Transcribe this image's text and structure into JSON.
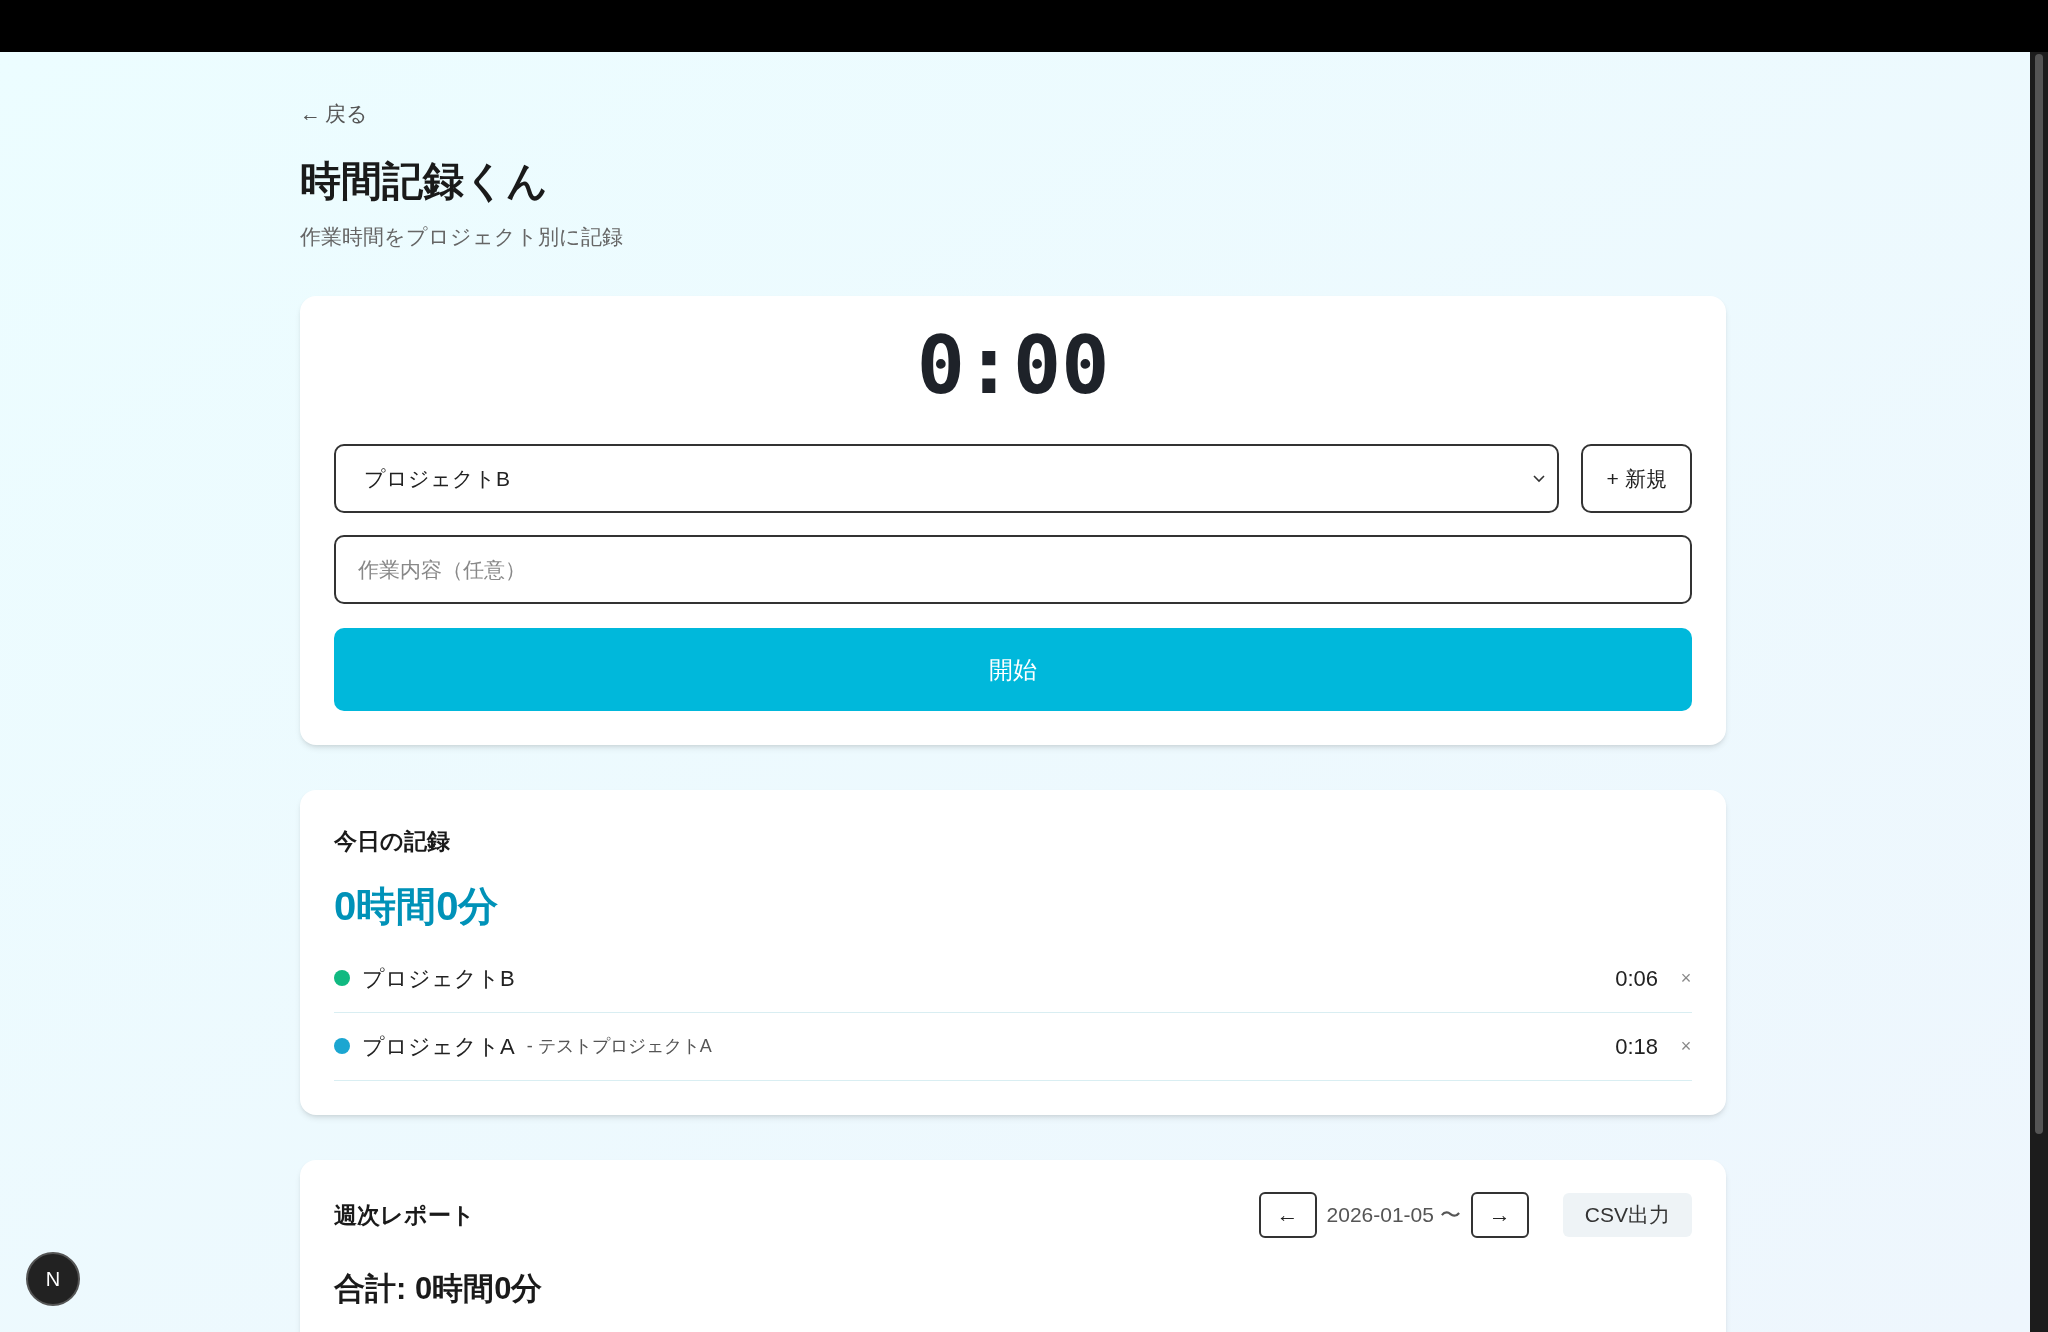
{
  "back_link": {
    "arrow": "←",
    "label": "戻る"
  },
  "header": {
    "title": "時間記録くん",
    "subtitle": "作業時間をプロジェクト別に記録"
  },
  "timer": {
    "display": "0:00",
    "project_select": {
      "value": "プロジェクトB"
    },
    "new_button": "+ 新規",
    "task_input": {
      "placeholder": "作業内容（任意）"
    },
    "start_button": "開始"
  },
  "today": {
    "title": "今日の記録",
    "total": "0時間0分",
    "entries": [
      {
        "project": "プロジェクトB",
        "color": "#10b981",
        "time": "0:06",
        "delete": "×"
      },
      {
        "project": "プロジェクトA",
        "note": "- テストプロジェクトA",
        "color": "#1ba6d1",
        "time": "0:18",
        "delete": "×"
      }
    ]
  },
  "weekly": {
    "title": "週次レポート",
    "prev": "←",
    "week": "2026-01-05 〜",
    "next": "→",
    "csv_button": "CSV出力",
    "total": "合計: 0時間0分"
  },
  "dev_badge": "N"
}
